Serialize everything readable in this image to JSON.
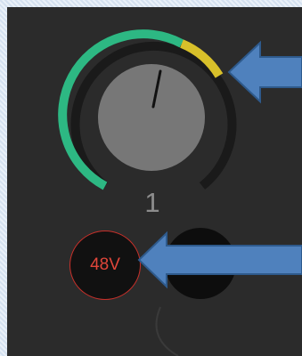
{
  "gain": {
    "channel_number": "1",
    "level": 0.78,
    "arc_green": "#2db883",
    "arc_yellow": "#d8c02a",
    "arc_track": "#1a1a1a",
    "knob_color": "#777777"
  },
  "phantom": {
    "label": "48V",
    "color": "#e0463a"
  },
  "callouts": {
    "arrow_color": "#4f81bd",
    "arrow_border": "#2e5a8c"
  }
}
